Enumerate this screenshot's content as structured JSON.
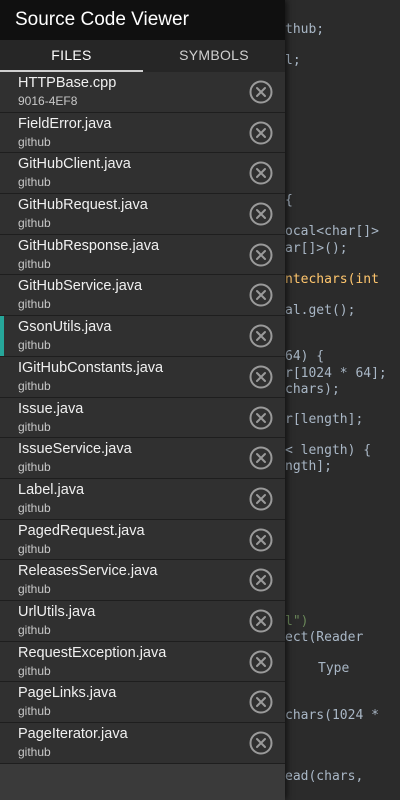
{
  "app": {
    "title": "Source Code Viewer"
  },
  "tabs": [
    {
      "label": "FILES",
      "active": true
    },
    {
      "label": "SYMBOLS",
      "active": false
    }
  ],
  "files": [
    {
      "name": "HTTPBase.cpp",
      "sub": "9016-4EF8",
      "marked": false
    },
    {
      "name": "FieldError.java",
      "sub": "github",
      "marked": false
    },
    {
      "name": "GitHubClient.java",
      "sub": "github",
      "marked": false
    },
    {
      "name": "GitHubRequest.java",
      "sub": "github",
      "marked": false
    },
    {
      "name": "GitHubResponse.java",
      "sub": "github",
      "marked": false
    },
    {
      "name": "GitHubService.java",
      "sub": "github",
      "marked": false
    },
    {
      "name": "GsonUtils.java",
      "sub": "github",
      "marked": true
    },
    {
      "name": "IGitHubConstants.java",
      "sub": "github",
      "marked": false
    },
    {
      "name": "Issue.java",
      "sub": "github",
      "marked": false
    },
    {
      "name": "IssueService.java",
      "sub": "github",
      "marked": false
    },
    {
      "name": "Label.java",
      "sub": "github",
      "marked": false
    },
    {
      "name": "PagedRequest.java",
      "sub": "github",
      "marked": false
    },
    {
      "name": "ReleasesService.java",
      "sub": "github",
      "marked": false
    },
    {
      "name": "UrlUtils.java",
      "sub": "github",
      "marked": false
    },
    {
      "name": "RequestException.java",
      "sub": "github",
      "marked": false
    },
    {
      "name": "PageLinks.java",
      "sub": "github",
      "marked": false
    },
    {
      "name": "PageIterator.java",
      "sub": "github",
      "marked": false
    }
  ],
  "code_fragments": [
    {
      "text": "thub;"
    },
    {
      "text": "l;"
    },
    {
      "text": "{"
    },
    {
      "text": "ocal<char[]>"
    },
    {
      "text": "ar[]>();"
    },
    {
      "text": "ntechars(int"
    },
    {
      "text": "al.get();"
    },
    {
      "text": "64) {"
    },
    {
      "text": "r[1024 * 64];"
    },
    {
      "text": "chars);"
    },
    {
      "text": "r[length];"
    },
    {
      "text": "< length) {"
    },
    {
      "text": "ngth];"
    },
    {
      "text": "l\")"
    },
    {
      "text": "ect(Reader"
    },
    {
      "text": "Type"
    },
    {
      "text": "chars(1024 *"
    },
    {
      "text": "ead(chars,"
    }
  ],
  "colors": {
    "accent": "#26a69a",
    "drawer_bg": "#303030",
    "header_bg": "#101010",
    "editor_bg": "#2b2b2b"
  },
  "icons": {
    "close": "close-circle-icon"
  }
}
